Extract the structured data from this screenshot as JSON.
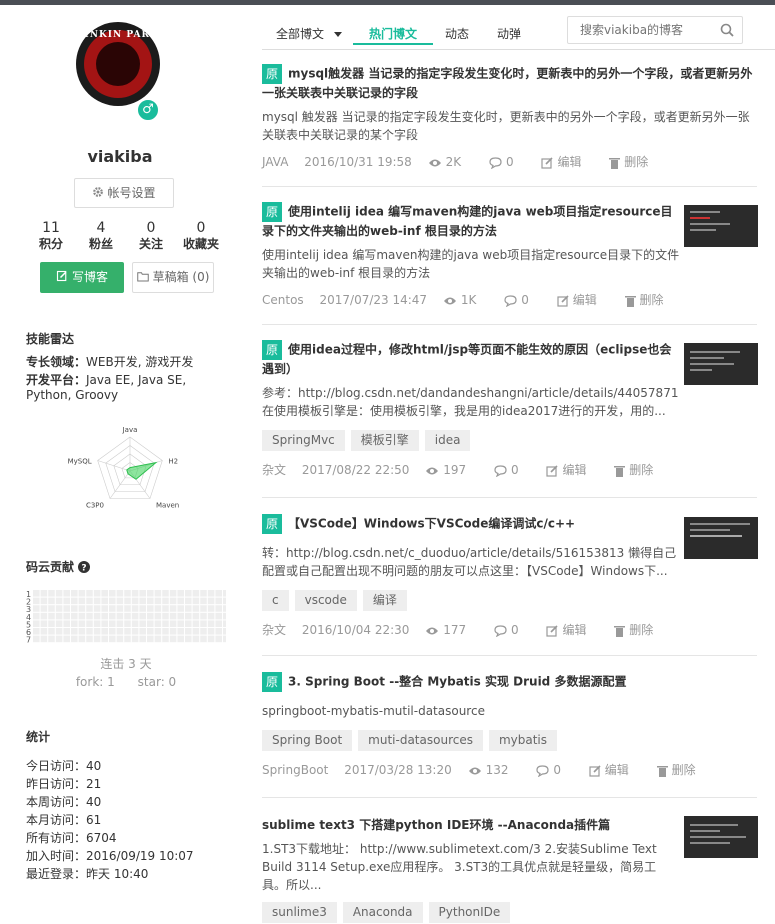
{
  "profile": {
    "avatar_text": "LINKIN PARK",
    "gender_symbol": "♂",
    "username": "viakiba",
    "account_settings": "帐号设置",
    "stats": [
      {
        "value": "11",
        "label": "积分"
      },
      {
        "value": "4",
        "label": "粉丝"
      },
      {
        "value": "0",
        "label": "关注"
      },
      {
        "value": "0",
        "label": "收藏夹"
      }
    ],
    "write_blog": "写博客",
    "drafts": "草稿箱 (0)"
  },
  "skills": {
    "heading": "技能雷达",
    "domain_label": "专长领域：",
    "domain_value": "WEB开发, 游戏开发",
    "platform_label": "开发平台：",
    "platform_value": "Java EE, Java SE, Python, Groovy",
    "radar_axes": [
      "Java",
      "H2",
      "Maven",
      "C3P0",
      "MySQL"
    ],
    "radar_values": [
      0.1,
      0.8,
      0.3,
      0.1,
      0.1
    ]
  },
  "contrib": {
    "heading": "码云贡献",
    "row_labels": [
      "1",
      "2",
      "3",
      "4",
      "5",
      "6",
      "7"
    ],
    "streak": "连击 3 天",
    "fork": "fork: 1",
    "star": "star: 0"
  },
  "visits": {
    "heading": "统计",
    "rows": [
      "今日访问：40",
      "昨日访问：21",
      "本周访问：40",
      "本月访问：61",
      "所有访问：6704",
      "加入时间：2016/09/19 10:07",
      "最近登录：昨天 10:40"
    ]
  },
  "tabs": {
    "all": "全部博文",
    "hot": "热门博文",
    "activity": "动态",
    "danmu": "动弹",
    "search_placeholder": "搜索viakiba的博客"
  },
  "icons": {
    "search": "search-icon",
    "views": "eye-icon",
    "comments": "comment-icon",
    "edit": "edit-icon",
    "delete": "trash-icon",
    "settings": "gear-icon",
    "pen": "pen-icon",
    "folder": "folder-icon",
    "help": "question-icon"
  },
  "colors": {
    "accent": "#1abc9c",
    "write_button": "#35b06b"
  },
  "posts": [
    {
      "badge": "原",
      "title": "mysql触发器 当记录的指定字段发生变化时，更新表中的另外一个字段，或者更新另外一张关联表中关联记录的字段",
      "summary": "mysql 触发器 当记录的指定字段发生变化时，更新表中的另外一个字段，或者更新另外一张关联表中关联记录的某个字段",
      "tags": [],
      "category": "JAVA",
      "date": "2016/10/31 19:58",
      "views": "2K",
      "comments": "0",
      "edit": "编辑",
      "delete": "删除"
    },
    {
      "badge": "原",
      "title": "使用intelij idea 编写maven构建的java web项目指定resource目录下的文件夹输出的web-inf 根目录的方法",
      "summary": "使用intelij idea 编写maven构建的java web项目指定resource目录下的文件夹输出的web-inf 根目录的方法",
      "tags": [],
      "category": "Centos",
      "date": "2017/07/23 14:47",
      "views": "1K",
      "comments": "0",
      "edit": "编辑",
      "delete": "删除"
    },
    {
      "badge": "原",
      "title": "使用idea过程中，修改html/jsp等页面不能生效的原因（eclipse也会遇到）",
      "summary": "参考：http://blog.csdn.net/dandandeshangni/article/details/44057871 在使用模板引擎是：使用模板引擎，我是用的idea2017进行的开发，用的...",
      "tags": [
        "SpringMvc",
        "模板引擎",
        "idea"
      ],
      "category": "杂文",
      "date": "2017/08/22 22:50",
      "views": "197",
      "comments": "0",
      "edit": "编辑",
      "delete": "删除"
    },
    {
      "badge": "原",
      "title": "【VSCode】Windows下VSCode编译调试c/c++",
      "summary": "转：http://blog.csdn.net/c_duoduo/article/details/51615381​3 懒得自己配置或自己配置出现不明问题的朋友可以点这里：【VSCode】Windows下...",
      "tags": [
        "c",
        "vscode",
        "编译"
      ],
      "category": "杂文",
      "date": "2016/10/04 22:30",
      "views": "177",
      "comments": "0",
      "edit": "编辑",
      "delete": "删除"
    },
    {
      "badge": "原",
      "title": "3. Spring Boot --整合 Mybatis 实现 Druid 多数据源配置",
      "summary": "springboot-mybatis-mutil-datasource",
      "tags": [
        "Spring Boot",
        "muti-datasources",
        "mybatis"
      ],
      "category": "SpringBoot",
      "date": "2017/03/28 13:20",
      "views": "132",
      "comments": "0",
      "edit": "编辑",
      "delete": "删除"
    },
    {
      "badge": "",
      "title": "sublime text3 下搭建python IDE环境 --Anaconda插件篇",
      "summary": "1.ST3下载地址： http://www.sublimetext.com/3 2.安装Sublime Text Build 3114 Setup.exe应用程序。 3.ST3的工具优点就是轻量级，简易工具。所以...",
      "tags": [
        "sunlime3",
        "Anaconda",
        "PythonIDe"
      ],
      "category": "",
      "date": "",
      "views": "",
      "comments": "",
      "edit": "",
      "delete": ""
    }
  ]
}
